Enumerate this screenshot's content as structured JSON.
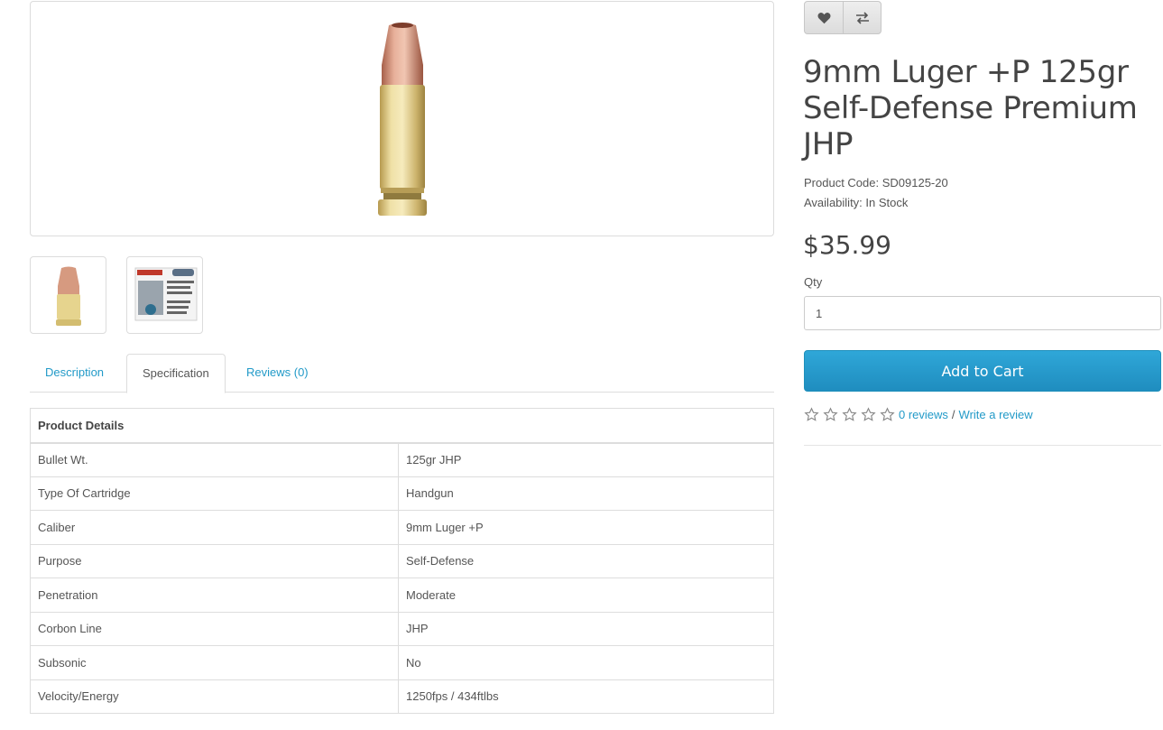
{
  "product": {
    "title": "9mm Luger +P 125gr Self-Defense Premium JHP",
    "code_label": "Product Code: SD09125-20",
    "availability_label": "Availability: In Stock",
    "price": "$35.99",
    "qty_label": "Qty",
    "qty_value": "1",
    "add_to_cart": "Add to Cart",
    "reviews_link": "0 reviews",
    "review_separator": "/",
    "write_review_link": "Write a review",
    "rating": 0,
    "rating_max": 5
  },
  "icons": {
    "wishlist": "heart-icon",
    "compare": "exchange-icon",
    "star": "star-outline-icon"
  },
  "tabs": [
    {
      "label": "Description",
      "active": false
    },
    {
      "label": "Specification",
      "active": true
    },
    {
      "label": "Reviews (0)",
      "active": false
    }
  ],
  "spec": {
    "header": "Product Details",
    "rows": [
      {
        "key": "Bullet Wt.",
        "value": "125gr JHP"
      },
      {
        "key": "Type Of Cartridge",
        "value": "Handgun"
      },
      {
        "key": "Caliber",
        "value": "9mm Luger +P"
      },
      {
        "key": "Purpose",
        "value": "Self-Defense"
      },
      {
        "key": "Penetration",
        "value": "Moderate"
      },
      {
        "key": "Corbon Line",
        "value": "JHP"
      },
      {
        "key": "Subsonic",
        "value": "No"
      },
      {
        "key": "Velocity/Energy",
        "value": "1250fps / 434ftlbs"
      }
    ]
  },
  "colors": {
    "link": "#229ac8",
    "cart_button": "#2397cc",
    "border": "#dddddd"
  }
}
